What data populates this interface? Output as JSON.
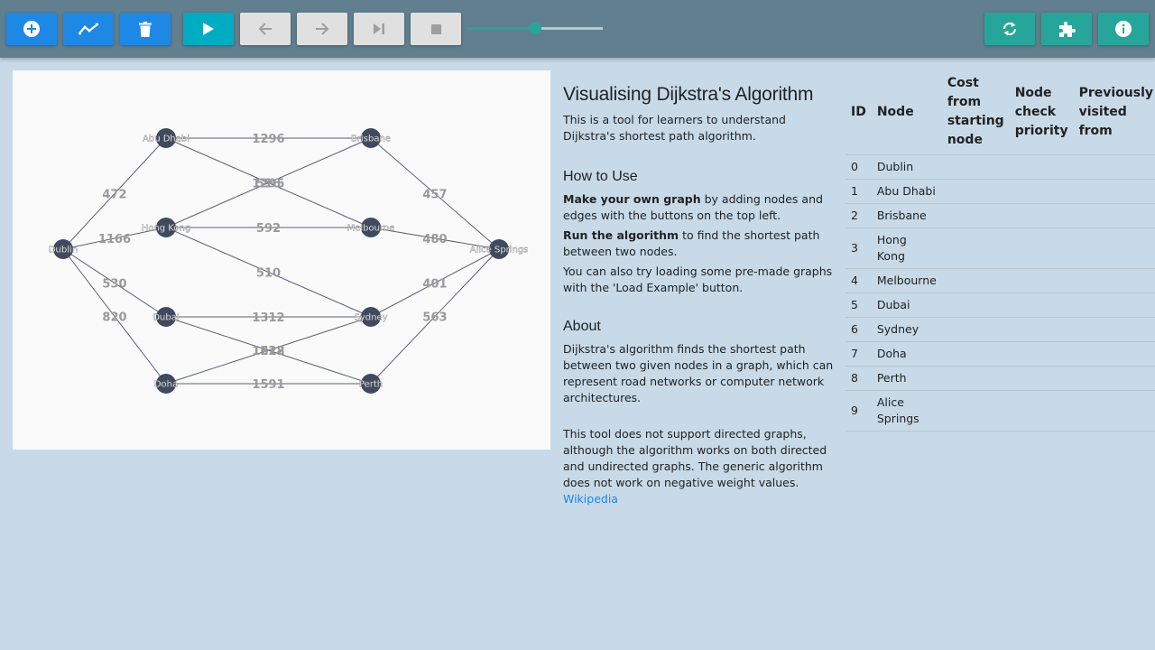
{
  "toolbar": {
    "left_buttons": [
      {
        "name": "add-node-button",
        "icon": "plus-circle-icon",
        "color": "#1e88e5"
      },
      {
        "name": "add-edge-button",
        "icon": "line-chart-icon",
        "color": "#1e88e5"
      },
      {
        "name": "delete-button",
        "icon": "trash-icon",
        "color": "#1e88e5"
      }
    ],
    "playback_buttons": [
      {
        "name": "play-button",
        "icon": "play-icon",
        "color": "#00acc1"
      },
      {
        "name": "step-back-button",
        "icon": "arrow-left-icon",
        "color": "#e0e0e0"
      },
      {
        "name": "step-forward-button",
        "icon": "arrow-right-icon",
        "color": "#e0e0e0"
      },
      {
        "name": "skip-to-end-button",
        "icon": "skip-end-icon",
        "color": "#e0e0e0"
      },
      {
        "name": "stop-button",
        "icon": "stop-icon",
        "color": "#e0e0e0"
      }
    ],
    "speed_slider": {
      "value": 0.5
    },
    "right_buttons": [
      {
        "name": "reset-button",
        "icon": "refresh-icon",
        "color": "#26a69a"
      },
      {
        "name": "load-example-button",
        "icon": "puzzle-icon",
        "color": "#26a69a"
      },
      {
        "name": "info-button",
        "icon": "info-icon",
        "color": "#26a69a"
      }
    ]
  },
  "graph": {
    "nodes": [
      {
        "id": 0,
        "label": "Dublin"
      },
      {
        "id": 1,
        "label": "Abu Dhabi"
      },
      {
        "id": 2,
        "label": "Brisbane"
      },
      {
        "id": 3,
        "label": "Hong Kong"
      },
      {
        "id": 4,
        "label": "Melbourne"
      },
      {
        "id": 5,
        "label": "Dubai"
      },
      {
        "id": 6,
        "label": "Sydney"
      },
      {
        "id": 7,
        "label": "Doha"
      },
      {
        "id": 8,
        "label": "Perth"
      },
      {
        "id": 9,
        "label": "Alice Springs"
      }
    ],
    "edges": [
      {
        "from": 0,
        "to": 1,
        "weight": "472"
      },
      {
        "from": 0,
        "to": 3,
        "weight": "1166"
      },
      {
        "from": 0,
        "to": 5,
        "weight": "530"
      },
      {
        "from": 0,
        "to": 7,
        "weight": "820"
      },
      {
        "from": 1,
        "to": 2,
        "weight": "1296"
      },
      {
        "from": 1,
        "to": 4,
        "weight": "1295"
      },
      {
        "from": 3,
        "to": 2,
        "weight": "516"
      },
      {
        "from": 3,
        "to": 4,
        "weight": "592"
      },
      {
        "from": 3,
        "to": 6,
        "weight": "510"
      },
      {
        "from": 5,
        "to": 6,
        "weight": "1312"
      },
      {
        "from": 5,
        "to": 8,
        "weight": "1228"
      },
      {
        "from": 7,
        "to": 6,
        "weight": "1612"
      },
      {
        "from": 7,
        "to": 8,
        "weight": "1591"
      },
      {
        "from": 2,
        "to": 9,
        "weight": "457"
      },
      {
        "from": 4,
        "to": 9,
        "weight": "480"
      },
      {
        "from": 6,
        "to": 9,
        "weight": "401"
      },
      {
        "from": 8,
        "to": 9,
        "weight": "563"
      }
    ],
    "node_color": "#3f4a60",
    "edge_color": "#5a5f78"
  },
  "info": {
    "title": "Visualising Dijkstra's Algorithm",
    "intro": "This is a tool for learners to understand Dijkstra's shortest path algorithm.",
    "how_to_heading": "How to Use",
    "how_to_1_bold": "Make your own graph",
    "how_to_1_rest": " by adding nodes and edges with the buttons on the top left.",
    "how_to_2_bold": "Run the algorithm",
    "how_to_2_rest": " to find the shortest path between two nodes.",
    "how_to_3": "You can also try loading some pre-made graphs with the 'Load Example' button.",
    "about_heading": "About",
    "about_1": "Dijkstra's algorithm finds the shortest path between two given nodes in a graph, which can represent road networks or computer network architectures.",
    "about_2": "This tool does not support directed graphs, although the algorithm works on both directed and undirected graphs. The generic algorithm does not work on negative weight values. ",
    "wiki_link": "Wikipedia"
  },
  "table": {
    "headers": [
      "ID",
      "Node",
      "Cost from starting node",
      "Node check priority",
      "Previously visited from"
    ],
    "rows": [
      [
        "0",
        "Dublin",
        "",
        "",
        ""
      ],
      [
        "1",
        "Abu Dhabi",
        "",
        "",
        ""
      ],
      [
        "2",
        "Brisbane",
        "",
        "",
        ""
      ],
      [
        "3",
        "Hong Kong",
        "",
        "",
        ""
      ],
      [
        "4",
        "Melbourne",
        "",
        "",
        ""
      ],
      [
        "5",
        "Dubai",
        "",
        "",
        ""
      ],
      [
        "6",
        "Sydney",
        "",
        "",
        ""
      ],
      [
        "7",
        "Doha",
        "",
        "",
        ""
      ],
      [
        "8",
        "Perth",
        "",
        "",
        ""
      ],
      [
        "9",
        "Alice Springs",
        "",
        "",
        ""
      ]
    ]
  }
}
